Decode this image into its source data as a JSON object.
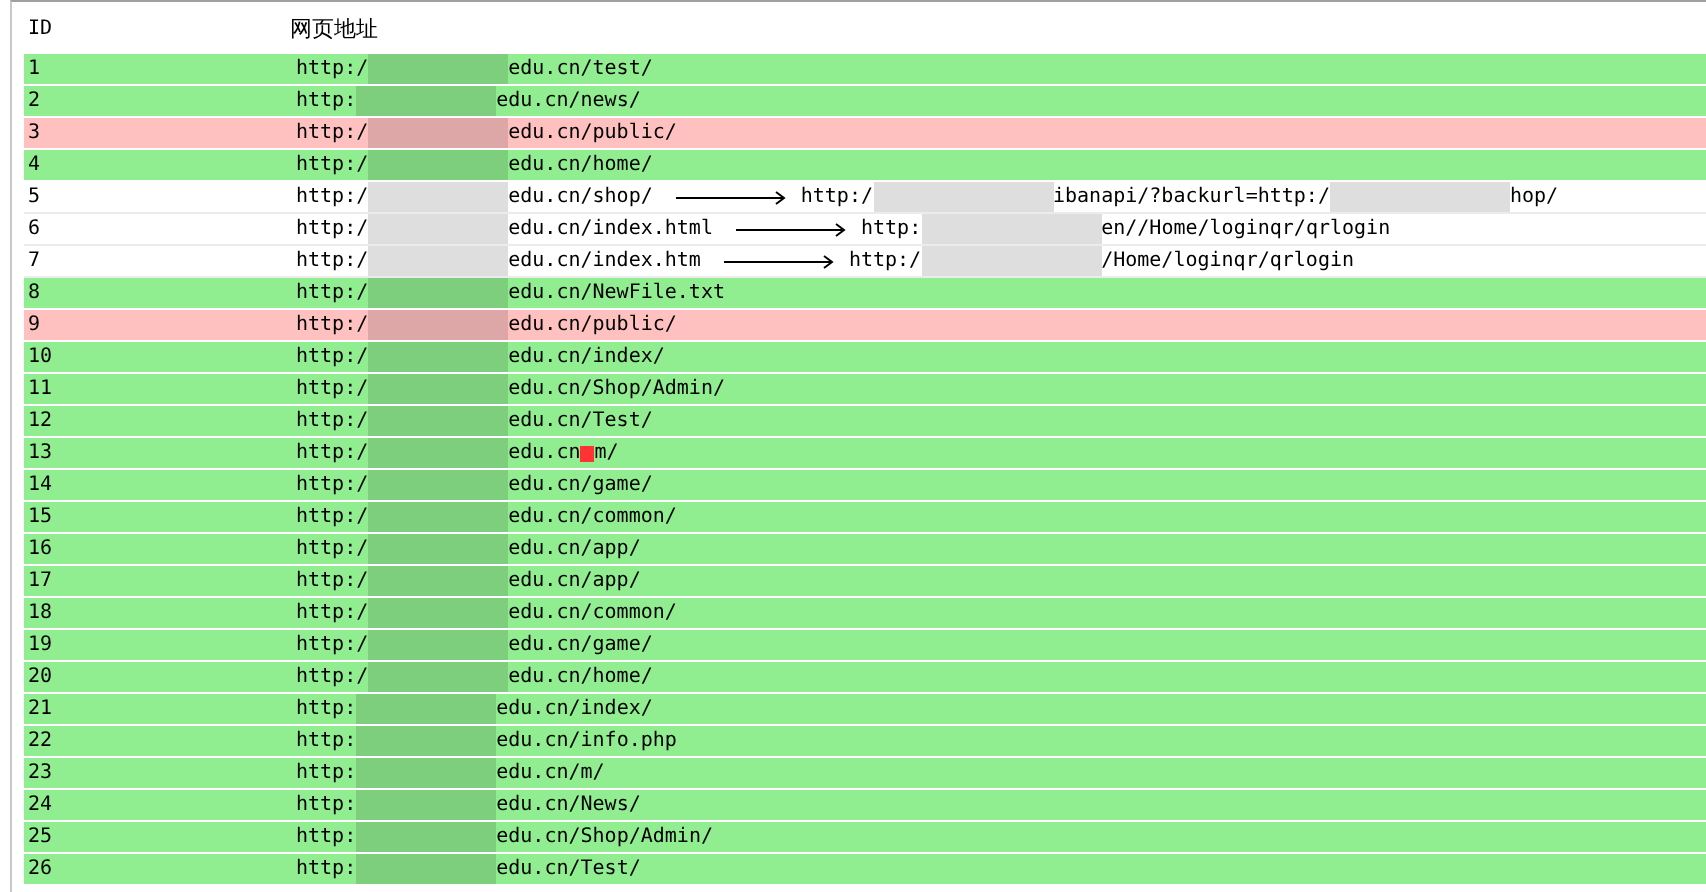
{
  "table": {
    "columns": [
      "ID",
      "网页地址"
    ],
    "rows": [
      {
        "id": "1",
        "color": "#90ee90",
        "url": [
          {
            "kind": "text",
            "text": "http:/"
          },
          {
            "kind": "redacted"
          },
          {
            "kind": "text",
            "text": "edu.cn/test/"
          }
        ]
      },
      {
        "id": "2",
        "color": "#90ee90",
        "url": [
          {
            "kind": "text",
            "text": "http:"
          },
          {
            "kind": "redacted"
          },
          {
            "kind": "text",
            "text": "edu.cn/news/"
          }
        ]
      },
      {
        "id": "3",
        "color": "#ffc0c0",
        "url": [
          {
            "kind": "text",
            "text": "http:/"
          },
          {
            "kind": "redacted"
          },
          {
            "kind": "text",
            "text": "edu.cn/public/"
          }
        ]
      },
      {
        "id": "4",
        "color": "#90ee90",
        "url": [
          {
            "kind": "text",
            "text": "http:/"
          },
          {
            "kind": "redacted"
          },
          {
            "kind": "text",
            "text": "edu.cn/home/"
          }
        ]
      },
      {
        "id": "5",
        "color": "#ffffff",
        "url": [
          {
            "kind": "text",
            "text": "http:/"
          },
          {
            "kind": "redacted"
          },
          {
            "kind": "text",
            "text": "edu.cn/shop/"
          },
          {
            "kind": "arrow"
          },
          {
            "kind": "text",
            "text": "http:/"
          },
          {
            "kind": "redacted"
          },
          {
            "kind": "text",
            "text": "ibanapi/?backurl=http:/"
          },
          {
            "kind": "redacted"
          },
          {
            "kind": "text",
            "text": "hop/"
          }
        ]
      },
      {
        "id": "6",
        "color": "#ffffff",
        "url": [
          {
            "kind": "text",
            "text": "http:/"
          },
          {
            "kind": "redacted"
          },
          {
            "kind": "text",
            "text": "edu.cn/index.html"
          },
          {
            "kind": "arrow"
          },
          {
            "kind": "text",
            "text": "http:"
          },
          {
            "kind": "redacted"
          },
          {
            "kind": "text",
            "text": "en//Home/loginqr/qrlogin"
          }
        ]
      },
      {
        "id": "7",
        "color": "#ffffff",
        "url": [
          {
            "kind": "text",
            "text": "http:/"
          },
          {
            "kind": "redacted"
          },
          {
            "kind": "text",
            "text": "edu.cn/index.htm"
          },
          {
            "kind": "arrow"
          },
          {
            "kind": "text",
            "text": "http:/"
          },
          {
            "kind": "redacted"
          },
          {
            "kind": "text",
            "text": "/Home/loginqr/qrlogin"
          }
        ]
      },
      {
        "id": "8",
        "color": "#90ee90",
        "url": [
          {
            "kind": "text",
            "text": "http:/"
          },
          {
            "kind": "redacted"
          },
          {
            "kind": "text",
            "text": "edu.cn/NewFile.txt"
          }
        ]
      },
      {
        "id": "9",
        "color": "#ffc0c0",
        "url": [
          {
            "kind": "text",
            "text": "http:/"
          },
          {
            "kind": "redacted"
          },
          {
            "kind": "text",
            "text": "edu.cn/public/"
          }
        ]
      },
      {
        "id": "10",
        "color": "#90ee90",
        "url": [
          {
            "kind": "text",
            "text": "http:/"
          },
          {
            "kind": "redacted"
          },
          {
            "kind": "text",
            "text": "edu.cn/index/"
          }
        ]
      },
      {
        "id": "11",
        "color": "#90ee90",
        "url": [
          {
            "kind": "text",
            "text": "http:/"
          },
          {
            "kind": "redacted"
          },
          {
            "kind": "text",
            "text": "edu.cn/Shop/Admin/"
          }
        ]
      },
      {
        "id": "12",
        "color": "#90ee90",
        "url": [
          {
            "kind": "text",
            "text": "http:/"
          },
          {
            "kind": "redacted"
          },
          {
            "kind": "text",
            "text": "edu.cn/Test/"
          }
        ]
      },
      {
        "id": "13",
        "color": "#90ee90",
        "url": [
          {
            "kind": "text",
            "text": "http:/"
          },
          {
            "kind": "redacted"
          },
          {
            "kind": "text",
            "text": "edu.cn"
          },
          {
            "kind": "mark"
          },
          {
            "kind": "text",
            "text": "m/"
          }
        ]
      },
      {
        "id": "14",
        "color": "#90ee90",
        "url": [
          {
            "kind": "text",
            "text": "http:/"
          },
          {
            "kind": "redacted"
          },
          {
            "kind": "text",
            "text": "edu.cn/game/"
          }
        ]
      },
      {
        "id": "15",
        "color": "#90ee90",
        "url": [
          {
            "kind": "text",
            "text": "http:/"
          },
          {
            "kind": "redacted"
          },
          {
            "kind": "text",
            "text": "edu.cn/common/"
          }
        ]
      },
      {
        "id": "16",
        "color": "#90ee90",
        "url": [
          {
            "kind": "text",
            "text": "http:/"
          },
          {
            "kind": "redacted"
          },
          {
            "kind": "text",
            "text": "edu.cn/app/"
          }
        ]
      },
      {
        "id": "17",
        "color": "#90ee90",
        "url": [
          {
            "kind": "text",
            "text": "http:/"
          },
          {
            "kind": "redacted"
          },
          {
            "kind": "text",
            "text": "edu.cn/app/"
          }
        ]
      },
      {
        "id": "18",
        "color": "#90ee90",
        "url": [
          {
            "kind": "text",
            "text": "http:/"
          },
          {
            "kind": "redacted"
          },
          {
            "kind": "text",
            "text": "edu.cn/common/"
          }
        ]
      },
      {
        "id": "19",
        "color": "#90ee90",
        "url": [
          {
            "kind": "text",
            "text": "http:/"
          },
          {
            "kind": "redacted"
          },
          {
            "kind": "text",
            "text": "edu.cn/game/"
          }
        ]
      },
      {
        "id": "20",
        "color": "#90ee90",
        "url": [
          {
            "kind": "text",
            "text": "http:/"
          },
          {
            "kind": "redacted"
          },
          {
            "kind": "text",
            "text": "edu.cn/home/"
          }
        ]
      },
      {
        "id": "21",
        "color": "#90ee90",
        "url": [
          {
            "kind": "text",
            "text": "http:"
          },
          {
            "kind": "redacted"
          },
          {
            "kind": "text",
            "text": "edu.cn/index/"
          }
        ]
      },
      {
        "id": "22",
        "color": "#90ee90",
        "url": [
          {
            "kind": "text",
            "text": "http:"
          },
          {
            "kind": "redacted"
          },
          {
            "kind": "text",
            "text": "edu.cn/info.php"
          }
        ]
      },
      {
        "id": "23",
        "color": "#90ee90",
        "url": [
          {
            "kind": "text",
            "text": "http:"
          },
          {
            "kind": "redacted"
          },
          {
            "kind": "text",
            "text": "edu.cn/m/"
          }
        ]
      },
      {
        "id": "24",
        "color": "#90ee90",
        "url": [
          {
            "kind": "text",
            "text": "http:"
          },
          {
            "kind": "redacted"
          },
          {
            "kind": "text",
            "text": "edu.cn/News/"
          }
        ]
      },
      {
        "id": "25",
        "color": "#90ee90",
        "url": [
          {
            "kind": "text",
            "text": "http:"
          },
          {
            "kind": "redacted"
          },
          {
            "kind": "text",
            "text": "edu.cn/Shop/Admin/"
          }
        ]
      },
      {
        "id": "26",
        "color": "#90ee90",
        "url": [
          {
            "kind": "text",
            "text": "http:"
          },
          {
            "kind": "redacted"
          },
          {
            "kind": "text",
            "text": "edu.cn/Test/"
          }
        ]
      }
    ]
  }
}
